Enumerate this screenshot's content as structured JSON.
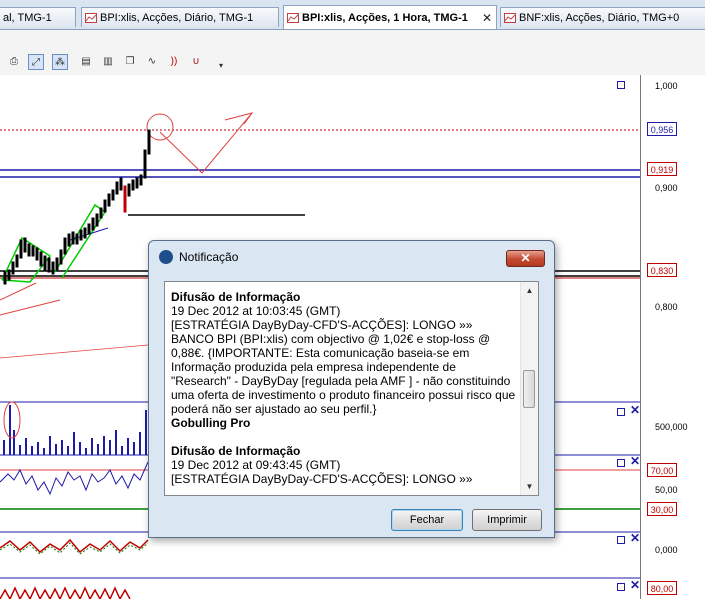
{
  "tabs": [
    {
      "label": "al, TMG-1"
    },
    {
      "label": "BPI:xlis, Acções, Diário, TMG-1"
    },
    {
      "label": "BPI:xlis, Acções, 1 Hora, TMG-1",
      "close": "✕"
    },
    {
      "label": "BNF:xlis, Acções, Diário, TMG+0"
    }
  ],
  "price_axis": {
    "ticks": [
      "1,000",
      "0,900",
      "0,800"
    ],
    "price_boxes": [
      {
        "label": "0,956",
        "color": "#1c1ca8"
      },
      {
        "label": "0,919",
        "color": "#c00000"
      },
      {
        "label": "0,830",
        "color": "#c00000"
      }
    ]
  },
  "volume_axis": {
    "ticks": [
      "500,000"
    ]
  },
  "rsi_axis": {
    "ticks": [
      "50,00"
    ],
    "boxes": [
      "70,00",
      "30,00"
    ]
  },
  "osc_axis": {
    "ticks": [
      "0,000"
    ],
    "boxes": [
      "80,00"
    ]
  },
  "dialog": {
    "title": "Notificação",
    "close_glyph": "✕",
    "messages": [
      {
        "heading": "Difusão de Informação",
        "timestamp": "19 Dec 2012 at 10:03:45 (GMT)",
        "body": "[ESTRATÉGIA DayByDay-CFD'S-ACÇÕES]: LONGO »» BANCO BPI (BPI:xlis) com objectivo @ 1,02€ e stop-loss @ 0,88€. {IMPORTANTE: Esta comunicação baseia-se em Informação produzida pela empresa independente de \"Research\" - DayByDay [regulada pela AMF ] - não constituindo uma oferta de investimento o produto financeiro possui risco que poderá não ser ajustado ao seu perfil.}",
        "signature": "Gobulling Pro"
      },
      {
        "heading": "Difusão de Informação",
        "timestamp": "19 Dec 2012 at 09:43:45 (GMT)",
        "body": "[ESTRATÉGIA DayByDay-CFD'S-ACÇÕES]: LONGO »»"
      }
    ],
    "buttons": {
      "close": "Fechar",
      "print": "Imprimir"
    }
  },
  "colors": {
    "accent": "#1c1ca8",
    "alert": "#c00000",
    "window": "#dbe6f3"
  }
}
